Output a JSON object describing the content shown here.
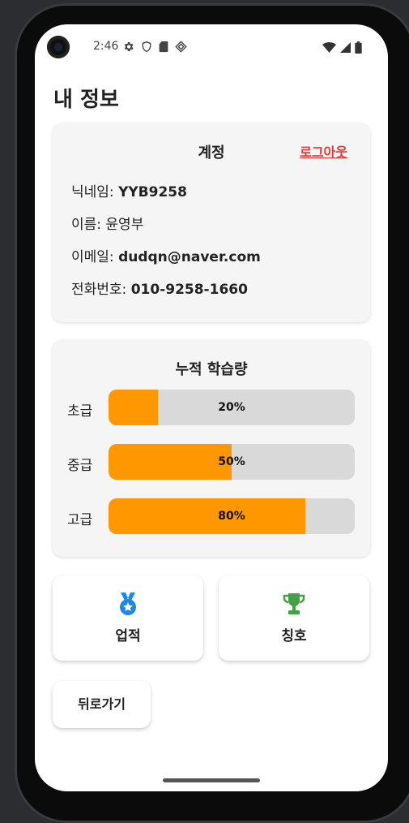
{
  "status_bar": {
    "time": "2:46",
    "left_icons": [
      "gear-icon",
      "shield-icon",
      "sd-card-icon",
      "cast-icon"
    ],
    "right_icons": [
      "wifi-icon",
      "signal-icon",
      "battery-icon"
    ]
  },
  "page": {
    "title": "내 정보"
  },
  "account": {
    "title": "계정",
    "logout_label": "로그아웃",
    "nickname_label": "닉네임: ",
    "nickname": "YYB9258",
    "name_label": "이름: ",
    "name": "윤영부",
    "email_label": "이메일: ",
    "email": "dudqn@naver.com",
    "phone_label": "전화번호: ",
    "phone": "010-9258-1660"
  },
  "study": {
    "title": "누적 학습량",
    "fill_color": "#FF9800",
    "levels": [
      {
        "label": "초급",
        "percent": 20,
        "text": "20%"
      },
      {
        "label": "중급",
        "percent": 50,
        "text": "50%"
      },
      {
        "label": "고급",
        "percent": 80,
        "text": "80%"
      }
    ]
  },
  "actions": {
    "achievements": {
      "label": "업적",
      "icon": "medal-icon",
      "color": "#1E88E5"
    },
    "titles": {
      "label": "칭호",
      "icon": "trophy-icon",
      "color": "#43A047"
    }
  },
  "back_label": "뒤로가기"
}
